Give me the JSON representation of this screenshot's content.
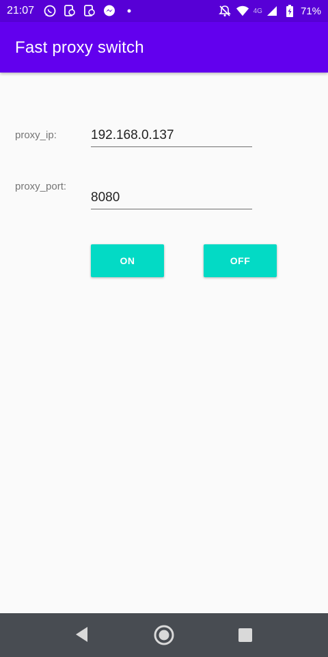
{
  "status_bar": {
    "time": "21:07",
    "network": "4G",
    "battery": "71%",
    "left_icons": [
      "whatsapp-icon",
      "notification-icon",
      "notification-icon",
      "messenger-icon",
      "dot-icon"
    ],
    "right_icons": [
      "notifications-off-icon",
      "wifi-icon",
      "signal-icon",
      "battery-charging-icon"
    ]
  },
  "app_bar": {
    "title": "Fast proxy switch"
  },
  "form": {
    "proxy_ip": {
      "label": "proxy_ip:",
      "value": "192.168.0.137"
    },
    "proxy_port": {
      "label": "proxy_port:",
      "value": "8080"
    }
  },
  "buttons": {
    "on": "ON",
    "off": "OFF"
  },
  "colors": {
    "status_bar": "#5700d6",
    "app_bar": "#6200ee",
    "button": "#03dac5",
    "nav_bar": "#484c52"
  },
  "nav": {
    "buttons": [
      "back-icon",
      "home-icon",
      "recents-icon"
    ]
  }
}
